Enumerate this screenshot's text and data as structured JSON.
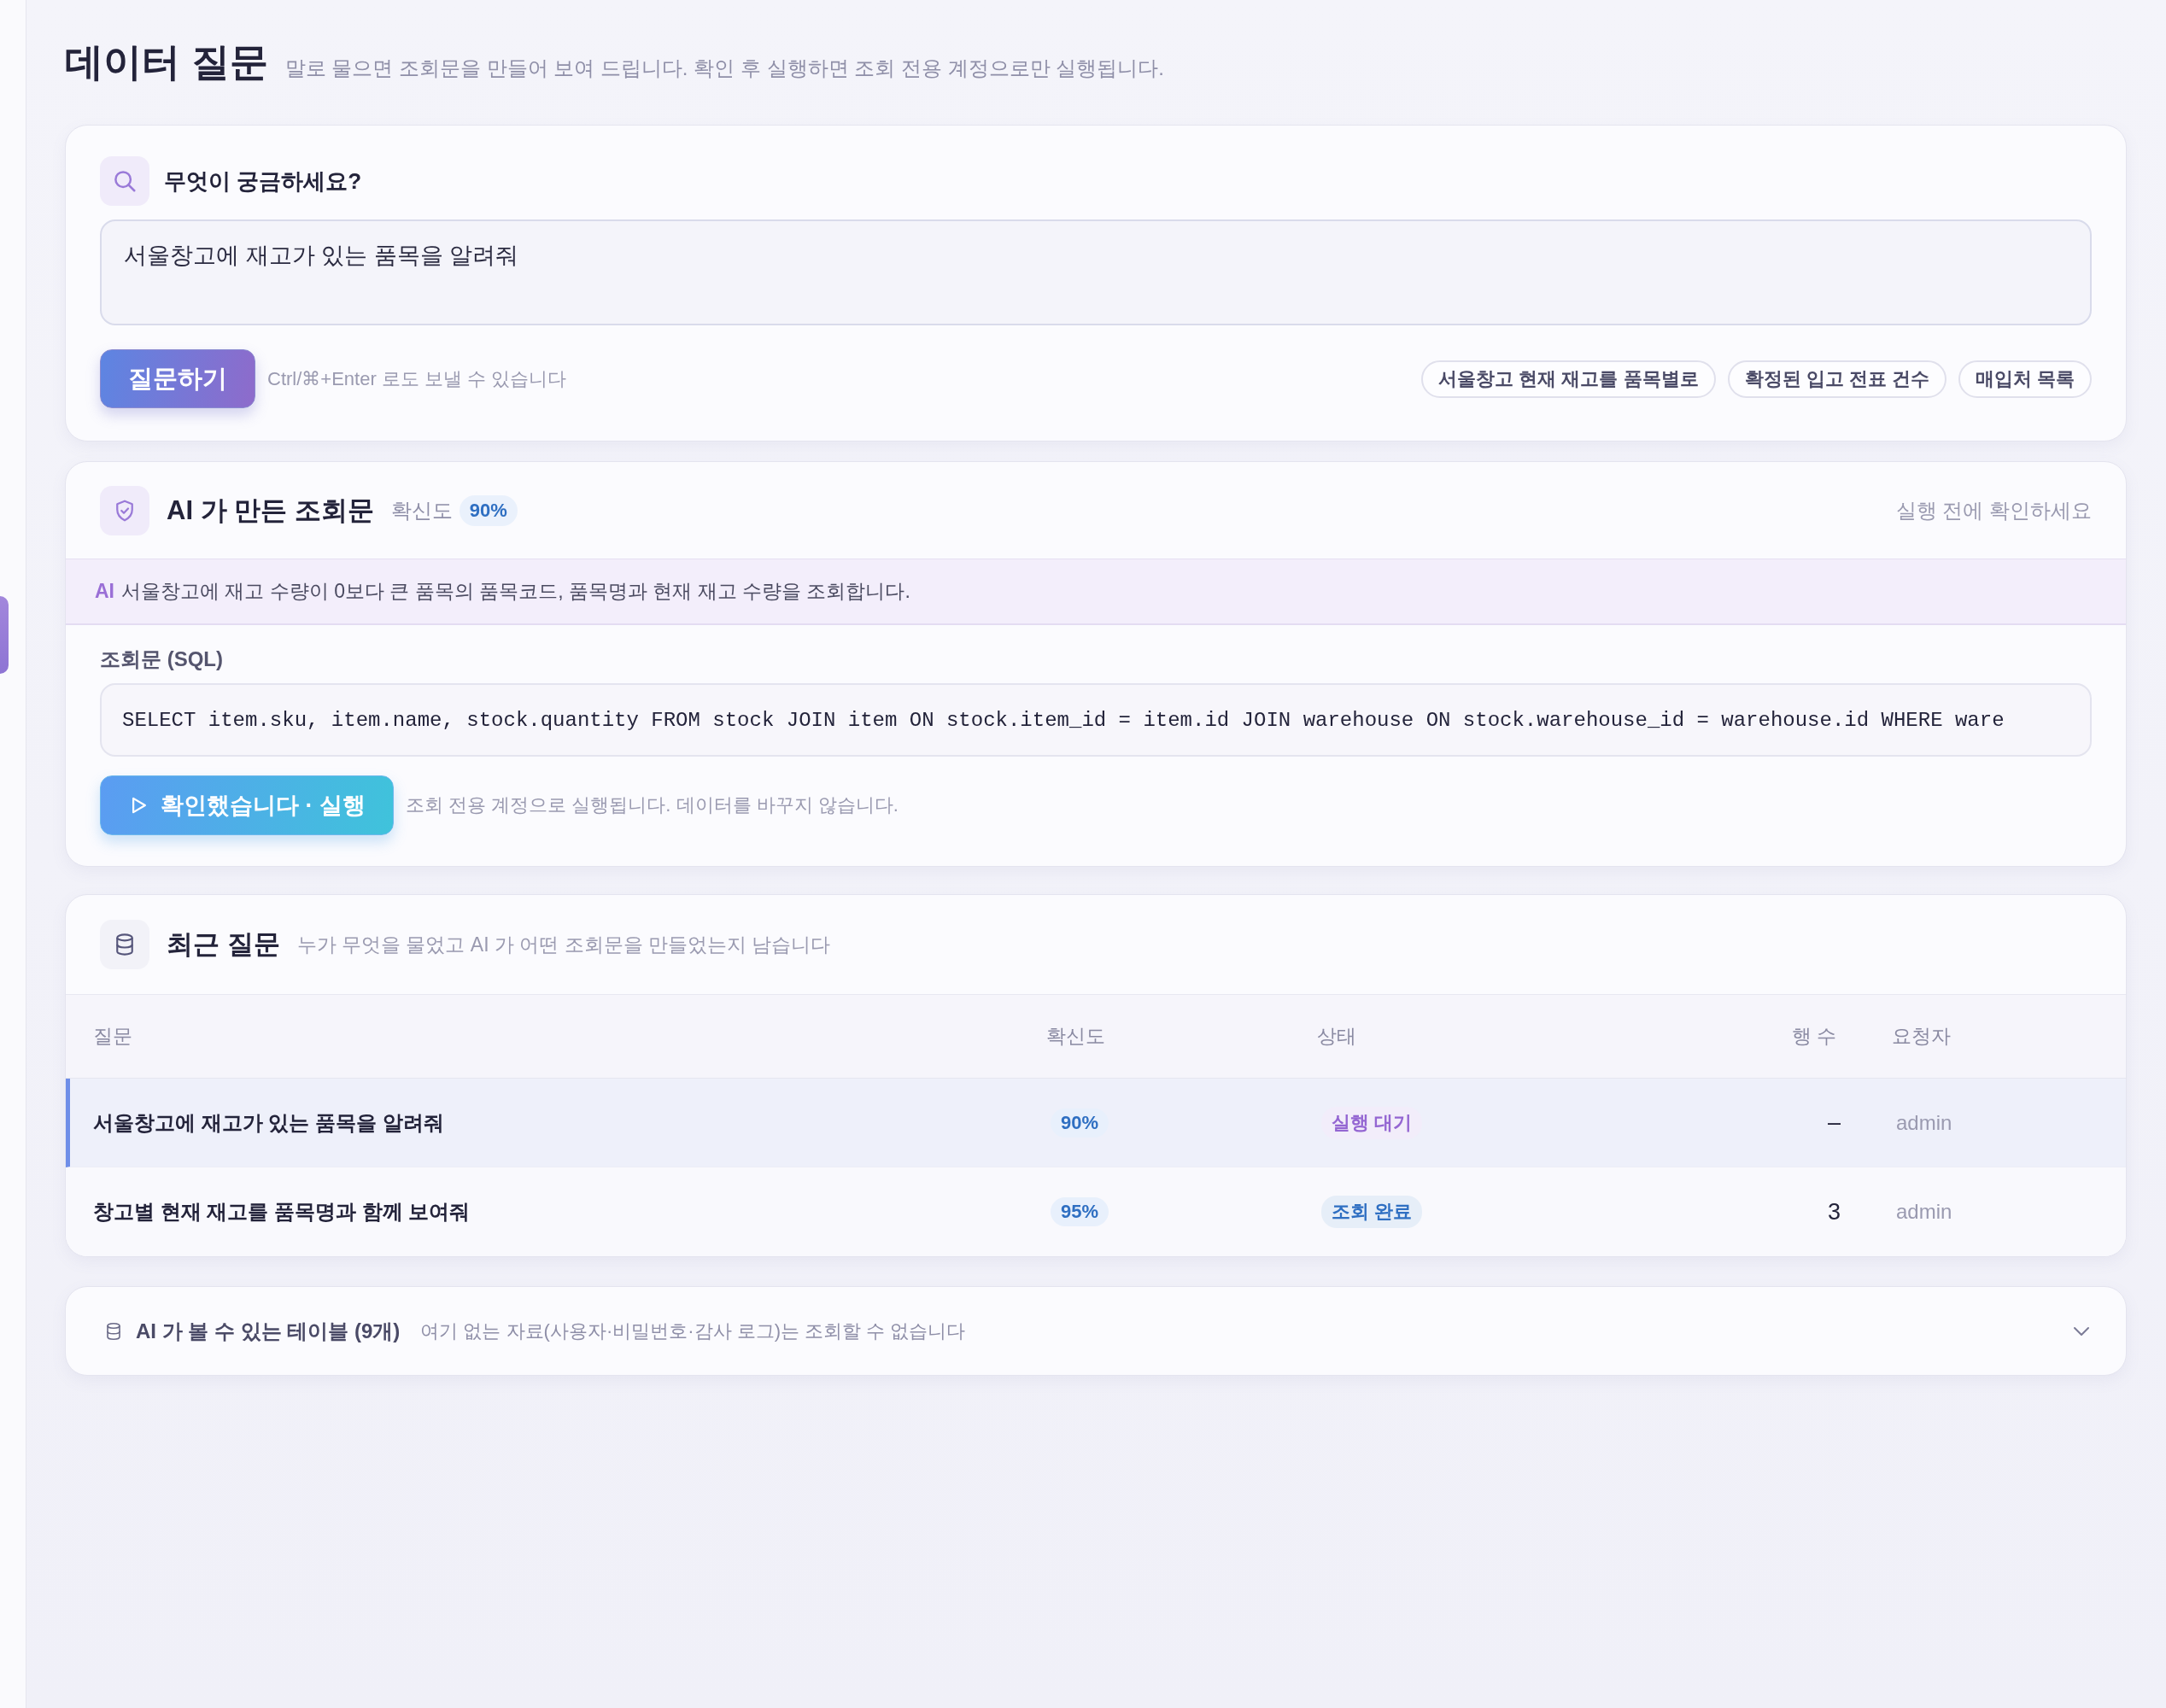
{
  "page": {
    "title": "데이터 질문",
    "subtitle": "말로 물으면 조회문을 만들어 보여 드립니다. 확인 후 실행하면 조회 전용 계정으로만 실행됩니다."
  },
  "ask": {
    "heading": "무엇이 궁금하세요?",
    "question": {
      "value": "서울창고에 재고가 있는 품목을 알려줘"
    },
    "submit_button": "질문하기",
    "hint": "Ctrl/⌘+Enter 로도 보낼 수 있습니다",
    "suggestions": [
      "서울창고 현재 재고를 품목별로",
      "확정된 입고 전표 건수",
      "매입처 목록"
    ]
  },
  "generated": {
    "title": "AI 가 만든 조회문",
    "confidence_label": "확신도",
    "confidence": "90%",
    "notice": "실행 전에 확인하세요",
    "explanation": {
      "tag": "AI",
      "text": "서울창고에 재고 수량이 0보다 큰 품목의 품목코드, 품목명과 현재 재고 수량을 조회합니다."
    },
    "sql_label": "조회문 (SQL)",
    "sql": "SELECT item.sku, item.name, stock.quantity FROM stock JOIN item ON stock.item_id = item.id JOIN warehouse ON stock.warehouse_id = warehouse.id WHERE ware",
    "run_button": "확인했습니다 · 실행",
    "run_hint": "조회 전용 계정으로 실행됩니다. 데이터를 바꾸지 않습니다."
  },
  "recent": {
    "title": "최근 질문",
    "subtitle": "누가 무엇을 물었고 AI 가 어떤 조회문을 만들었는지 남습니다",
    "columns": [
      "질문",
      "확신도",
      "상태",
      "행 수",
      "요청자"
    ],
    "rows": [
      {
        "selected": true,
        "question": "서울창고에 재고가 있는 품목을 알려줘",
        "confidence": "90%",
        "status": {
          "text": "실행 대기",
          "color": "#9466d2"
        },
        "row_count": "–",
        "requester": "admin"
      },
      {
        "selected": false,
        "question": "창고별 현재 재고를 품목명과 함께 보여줘",
        "confidence": "95%",
        "status": {
          "text": "조회 완료",
          "color": "#2f6fc2"
        },
        "row_count": "3",
        "requester": "admin"
      }
    ]
  },
  "tables_panel": {
    "title": "AI 가 볼 수 있는 테이블 (9개)",
    "subtitle": "여기 없는 자료(사용자·비밀번호·감사 로그)는 조회할 수 없습니다",
    "expanded": false
  }
}
